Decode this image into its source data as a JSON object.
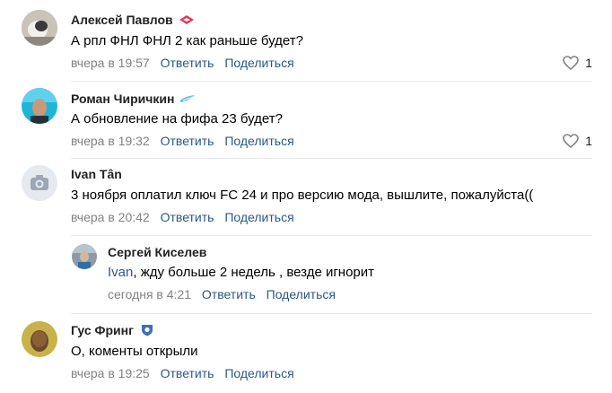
{
  "comments": [
    {
      "author": "Алексей Павлов",
      "text": "А рпл ФНЛ ФНЛ 2 как раньше будет?",
      "date": "вчера в 19:57",
      "reply": "Ответить",
      "share": "Поделиться",
      "likes": "1",
      "badge_icon": "spartak-logo-icon"
    },
    {
      "author": "Роман Чиричкин",
      "text": "А обновление на фифа 23 будет?",
      "date": "вчера в 19:32",
      "reply": "Ответить",
      "share": "Поделиться",
      "likes": "1",
      "badge_icon": "zenit-logo-icon"
    },
    {
      "author": "Ivan Tân",
      "text": "3 ноября оплатил ключ FC 24 и про версию мода, вышлите, пожалуйста((",
      "date": "вчера в 20:42",
      "reply": "Ответить",
      "share": "Поделиться",
      "avatar_icon": "camera-icon"
    },
    {
      "author": "Сергей Киселев",
      "mention": "Ivan",
      "text": ", жду больше 2 недель , везде игнорит",
      "date": "сегодня в 4:21",
      "reply": "Ответить",
      "share": "Поделиться"
    },
    {
      "author": "Гус Фринг",
      "text": "О, коменты открыли",
      "date": "вчера в 19:25",
      "reply": "Ответить",
      "share": "Поделиться",
      "badge_icon": "crest-logo-icon"
    }
  ]
}
